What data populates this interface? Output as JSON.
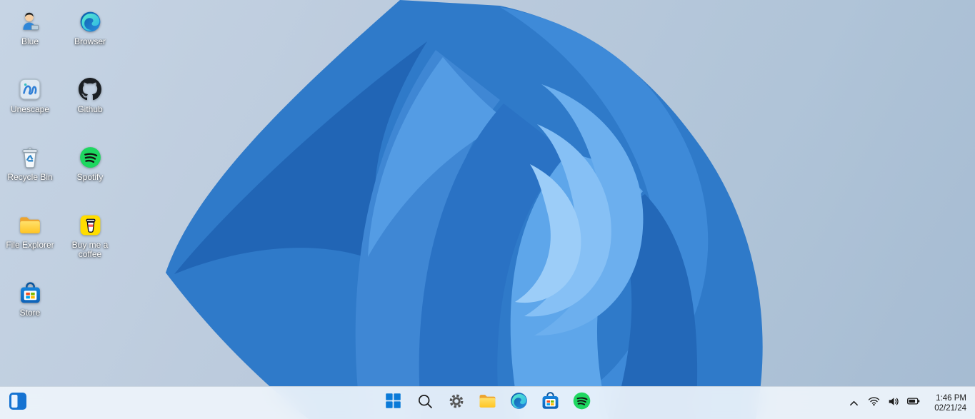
{
  "desktop": {
    "icons": [
      {
        "label": "Blue",
        "icon": "blue-avatar-icon"
      },
      {
        "label": "Browser",
        "icon": "edge-browser-icon"
      },
      {
        "label": "Unescape",
        "icon": "unescape-icon"
      },
      {
        "label": "Github",
        "icon": "github-icon"
      },
      {
        "label": "Recycle Bin",
        "icon": "recycle-bin-icon"
      },
      {
        "label": "Spotify",
        "icon": "spotify-icon"
      },
      {
        "label": "File Explorer",
        "icon": "file-explorer-icon"
      },
      {
        "label": "Buy me a coffee",
        "icon": "buy-me-a-coffee-icon"
      },
      {
        "label": "Store",
        "icon": "microsoft-store-icon"
      }
    ]
  },
  "taskbar": {
    "corner_button": {
      "name": "panel",
      "icon": "side-panel-icon"
    },
    "pinned": [
      {
        "name": "start",
        "icon": "windows-start-icon"
      },
      {
        "name": "search",
        "icon": "search-icon"
      },
      {
        "name": "settings",
        "icon": "settings-gear-icon"
      },
      {
        "name": "file-explorer",
        "icon": "folder-icon"
      },
      {
        "name": "edge-browser",
        "icon": "edge-browser-icon"
      },
      {
        "name": "store",
        "icon": "microsoft-store-icon"
      },
      {
        "name": "spotify",
        "icon": "spotify-icon"
      }
    ],
    "tray": {
      "hidden_icons": "chevron-up-icon",
      "network": "wifi-icon",
      "sound": "volume-icon",
      "power": "battery-icon",
      "time": "1:46 PM",
      "date": "02/21/24"
    }
  },
  "colors": {
    "accent_blue": "#0a7ad8",
    "spotify_green": "#1ed760",
    "bmc_yellow": "#ffdd00",
    "folder_yellow": "#ffc524",
    "taskbar_bg": "#eef4fb",
    "wallpaper_blues": [
      "#1f65b4",
      "#2f7ac9",
      "#3e8ad8",
      "#5ea6ea",
      "#86c0f5",
      "#9ccdf8"
    ]
  }
}
